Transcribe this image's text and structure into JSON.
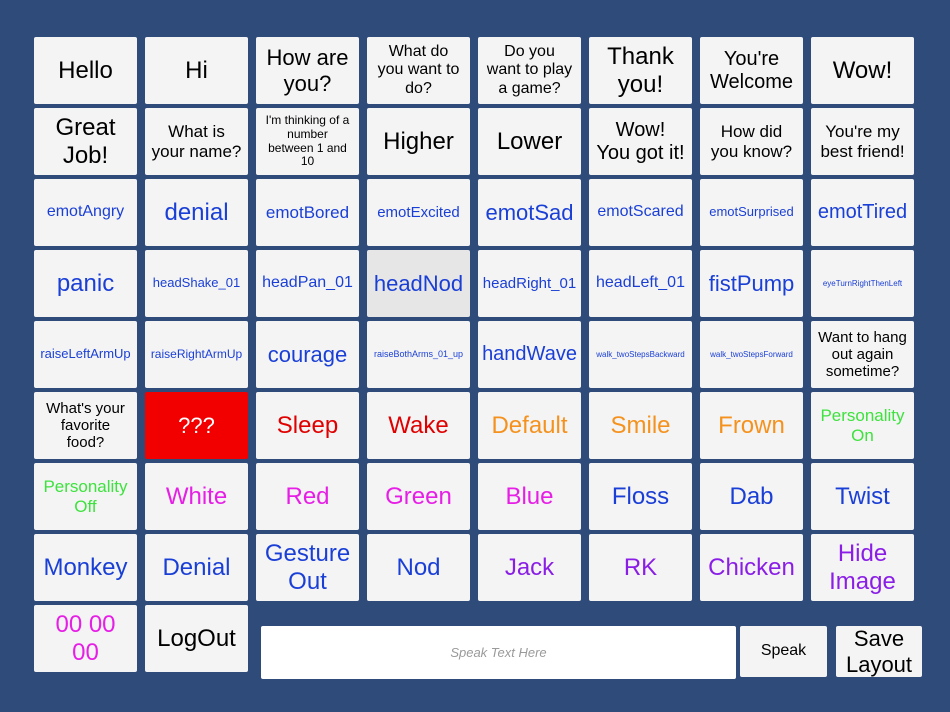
{
  "buttons": [
    {
      "label": "Hello",
      "color": "#000000"
    },
    {
      "label": "Hi",
      "color": "#000000"
    },
    {
      "label": "How are\nyou?",
      "color": "#000000"
    },
    {
      "label": "What do\nyou want to\ndo?",
      "color": "#000000"
    },
    {
      "label": "Do you\nwant to play\na game?",
      "color": "#000000"
    },
    {
      "label": "Thank\nyou!",
      "color": "#000000"
    },
    {
      "label": "You're\nWelcome",
      "color": "#000000"
    },
    {
      "label": "Wow!",
      "color": "#000000"
    },
    {
      "label": "Great\nJob!",
      "color": "#000000"
    },
    {
      "label": "What is\nyour name?",
      "color": "#000000"
    },
    {
      "label": "I'm thinking of a\nnumber\nbetween 1 and\n10",
      "color": "#000000"
    },
    {
      "label": "Higher",
      "color": "#000000"
    },
    {
      "label": "Lower",
      "color": "#000000"
    },
    {
      "label": "Wow!\nYou got it!",
      "color": "#000000"
    },
    {
      "label": "How did\nyou know?",
      "color": "#000000"
    },
    {
      "label": "You're my\nbest friend!",
      "color": "#000000"
    },
    {
      "label": "emotAngry",
      "color": "#1a3fd6"
    },
    {
      "label": "denial",
      "color": "#1a3fd6"
    },
    {
      "label": "emotBored",
      "color": "#1a3fd6"
    },
    {
      "label": "emotExcited",
      "color": "#1a3fd6"
    },
    {
      "label": "emotSad",
      "color": "#1a3fd6"
    },
    {
      "label": "emotScared",
      "color": "#1a3fd6"
    },
    {
      "label": "emotSurprised",
      "color": "#1a3fd6"
    },
    {
      "label": "emotTired",
      "color": "#1a3fd6"
    },
    {
      "label": "panic",
      "color": "#1a3fd6"
    },
    {
      "label": "headShake_01",
      "color": "#1a3fd6"
    },
    {
      "label": "headPan_01",
      "color": "#1a3fd6"
    },
    {
      "label": "headNod",
      "color": "#1a3fd6",
      "highlighted": true
    },
    {
      "label": "headRight_01",
      "color": "#1a3fd6"
    },
    {
      "label": "headLeft_01",
      "color": "#1a3fd6"
    },
    {
      "label": "fistPump",
      "color": "#1a3fd6"
    },
    {
      "label": "eyeTurnRightThenLeft",
      "color": "#1a3fd6"
    },
    {
      "label": "raiseLeftArmUp",
      "color": "#1a3fd6"
    },
    {
      "label": "raiseRightArmUp",
      "color": "#1a3fd6"
    },
    {
      "label": "courage",
      "color": "#1a3fd6"
    },
    {
      "label": "raiseBothArms_01_up",
      "color": "#1a3fd6"
    },
    {
      "label": "handWave",
      "color": "#1a3fd6"
    },
    {
      "label": "walk_twoStepsBackward",
      "color": "#1a3fd6"
    },
    {
      "label": "walk_twoStepsForward",
      "color": "#1a3fd6"
    },
    {
      "label": "Want to hang\nout again\nsometime?",
      "color": "#000000"
    },
    {
      "label": "What's your\nfavorite\nfood?",
      "color": "#000000"
    },
    {
      "label": "???",
      "color": "#ffffff",
      "background": "#f20000"
    },
    {
      "label": "Sleep",
      "color": "#e00000"
    },
    {
      "label": "Wake",
      "color": "#e00000"
    },
    {
      "label": "Default",
      "color": "#f5921e"
    },
    {
      "label": "Smile",
      "color": "#f5921e"
    },
    {
      "label": "Frown",
      "color": "#f5921e"
    },
    {
      "label": "Personality\nOn",
      "color": "#3ee23e"
    },
    {
      "label": "Personality\nOff",
      "color": "#3ee23e"
    },
    {
      "label": "White",
      "color": "#e61ee6"
    },
    {
      "label": "Red",
      "color": "#e61ee6"
    },
    {
      "label": "Green",
      "color": "#e61ee6"
    },
    {
      "label": "Blue",
      "color": "#e61ee6"
    },
    {
      "label": "Floss",
      "color": "#1a3fd6"
    },
    {
      "label": "Dab",
      "color": "#1a3fd6"
    },
    {
      "label": "Twist",
      "color": "#1a3fd6"
    },
    {
      "label": "Monkey",
      "color": "#1a3fd6"
    },
    {
      "label": "Denial",
      "color": "#1a3fd6"
    },
    {
      "label": "Gesture\nOut",
      "color": "#1a3fd6"
    },
    {
      "label": "Nod",
      "color": "#1a3fd6"
    },
    {
      "label": "Jack",
      "color": "#8a1ee6"
    },
    {
      "label": "RK",
      "color": "#8a1ee6"
    },
    {
      "label": "Chicken",
      "color": "#8a1ee6"
    },
    {
      "label": "Hide\nImage",
      "color": "#8a1ee6"
    },
    {
      "label": "00 00\n00",
      "color": "#e61ee6"
    },
    {
      "label": "LogOut",
      "color": "#000000"
    }
  ],
  "speak_input": {
    "value": "",
    "placeholder": "Speak Text Here"
  },
  "speak_button": {
    "label": "Speak"
  },
  "save_layout_button": {
    "label": "Save\nLayout"
  }
}
